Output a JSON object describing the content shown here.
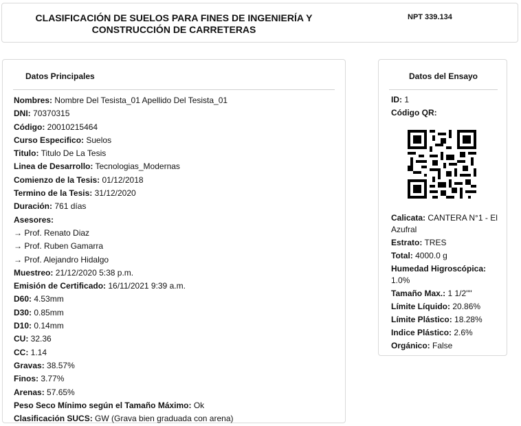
{
  "header": {
    "title_line1": "CLASIFICACIÓN DE SUELOS PARA FINES DE INGENIERÍA Y",
    "title_line2": "CONSTRUCCIÓN DE CARRETERAS",
    "norm": "NPT 339.134"
  },
  "main": {
    "title": "Datos Principales",
    "nombres_label": "Nombres:",
    "nombres": "Nombre Del Tesista_01 Apellido Del Tesista_01",
    "dni_label": "DNI:",
    "dni": "70370315",
    "codigo_label": "Código:",
    "codigo": "20010215464",
    "curso_label": "Curso Especifico:",
    "curso": "Suelos",
    "titulo_label": "Titulo:",
    "titulo": "Titulo De La Tesis",
    "linea_label": "Linea de Desarrollo:",
    "linea": "Tecnologias_Modernas",
    "comienzo_label": "Comienzo de la Tesis:",
    "comienzo": "01/12/2018",
    "termino_label": "Termino de la Tesis:",
    "termino": "31/12/2020",
    "duracion_label": "Duración:",
    "duracion": "761 días",
    "asesores_label": "Asesores:",
    "asesores": [
      "→ Prof. Renato Diaz",
      "→ Prof. Ruben Gamarra",
      "→ Prof. Alejandro Hidalgo"
    ],
    "muestreo_label": "Muestreo:",
    "muestreo": "21/12/2020 5:38 p.m.",
    "emision_label": "Emisión de Certificado:",
    "emision": "16/11/2021 9:39 a.m.",
    "d60_label": "D60:",
    "d60": "4.53mm",
    "d30_label": "D30:",
    "d30": "0.85mm",
    "d10_label": "D10:",
    "d10": "0.14mm",
    "cu_label": "CU:",
    "cu": "32.36",
    "cc_label": "CC:",
    "cc": "1.14",
    "gravas_label": "Gravas:",
    "gravas": "38.57%",
    "finos_label": "Finos:",
    "finos": "3.77%",
    "arenas_label": "Arenas:",
    "arenas": "57.65%",
    "peso_label": "Peso Seco Mínimo según el Tamaño Máximo:",
    "peso": "Ok",
    "sucs_label": "Clasificación SUCS:",
    "sucs": "GW (Grava bien graduada con arena)"
  },
  "test": {
    "title": "Datos del Ensayo",
    "id_label": "ID:",
    "id": "1",
    "qr_label": "Código QR:",
    "calicata_label": "Calicata:",
    "calicata": "CANTERA N°1 - El Azufral",
    "estrato_label": "Estrato:",
    "estrato": "TRES",
    "total_label": "Total:",
    "total": "4000.0 g",
    "humedad_label": "Humedad Higroscópica:",
    "humedad": "1.0%",
    "tamano_label": "Tamaño Max.:",
    "tamano": "1 1/2\"\"",
    "ll_label": "Límite Líquido:",
    "ll": "20.86%",
    "lp_label": "Límite Plástico:",
    "lp": "18.28%",
    "ip_label": "Indice Plástico:",
    "ip": "2.6%",
    "organico_label": "Orgánico:",
    "organico": "False"
  }
}
